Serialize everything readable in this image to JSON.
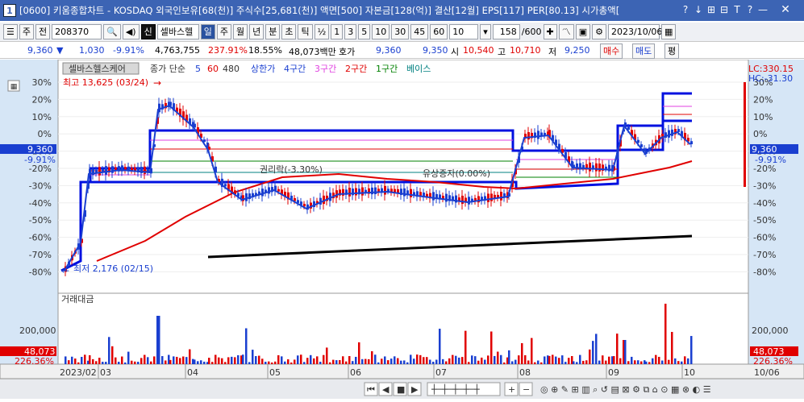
{
  "window": {
    "number": "1",
    "title": "[0600] 키움종합차트 - KOSDAQ 외국인보유[68(천)] 주식수[25,681(천)] 액면[500] 자본금[128(억)] 결산[12월] EPS[117] PER[80.13] 시가총액[",
    "buttons": [
      "?",
      "↓",
      "⊞",
      "⊟",
      "T",
      "?",
      "—",
      "✕"
    ]
  },
  "toolbar": {
    "market": "주",
    "scope": "전",
    "code": "208370",
    "search_icon": "🔍",
    "stock_name": "셀바스헬",
    "period_tabs": [
      "일",
      "주",
      "월",
      "년",
      "분",
      "초",
      "틱"
    ],
    "selected_period": "일",
    "intervals": [
      "½",
      "1",
      "3",
      "5",
      "10",
      "30",
      "45",
      "60"
    ],
    "count_select": "10",
    "range_value": "158",
    "range_total": "/600",
    "date": "2023/10/06"
  },
  "quote": {
    "price": "9,360",
    "change": "1,030",
    "change_pct": "-9.91%",
    "volume": "4,763,755",
    "volume_pct": "237.91%",
    "turnover": "18.55%",
    "amount": "48,073백만",
    "hoga_label": "호가",
    "bid": "9,360",
    "ask": "9,350",
    "open_label": "시",
    "open": "10,540",
    "high_label": "고",
    "high": "10,710",
    "low_label": "저",
    "low": "9,250",
    "buy_button": "매수",
    "sell_button": "매도",
    "eval_button": "평"
  },
  "legend": {
    "stock": "셀바스헬스케어",
    "ma_label": "종가 단순",
    "ma_values": [
      "5",
      "60",
      "480"
    ],
    "band_label": "상한가",
    "bands": [
      "4구간",
      "3구간",
      "2구간",
      "1구간",
      "베이스"
    ],
    "lc": "LC:330.15",
    "hc": "HC:-31.30"
  },
  "annotations": {
    "high": "최고 13,625 (03/24)",
    "low": "최저 2,176 (02/15)",
    "ex_rights": "권리락(-3.30%)",
    "rights_issue": "유상증자(0.00%)",
    "price_tag": "9,360",
    "pct_tag": "-9.91%",
    "volume_tag": "48,073",
    "volume_pct_tag": "226.36%"
  },
  "volume_panel": {
    "title": "거래대금",
    "tick": "200,000"
  },
  "chart_data": {
    "type": "candlestick",
    "y_axis_pct_ticks": [
      "30%",
      "20%",
      "10%",
      "0%",
      "-10%",
      "-20%",
      "-30%",
      "-40%",
      "-50%",
      "-60%",
      "-70%",
      "-80%"
    ],
    "x_axis_labels": [
      "2023/02",
      "03",
      "04",
      "05",
      "06",
      "07",
      "08",
      "09",
      "10",
      "10/06"
    ],
    "colors": {
      "up": "#e00000",
      "down": "#1a3fd0",
      "ma5": "#1a3fd0",
      "ma60": "#e00000",
      "band": "#0010e0"
    }
  }
}
